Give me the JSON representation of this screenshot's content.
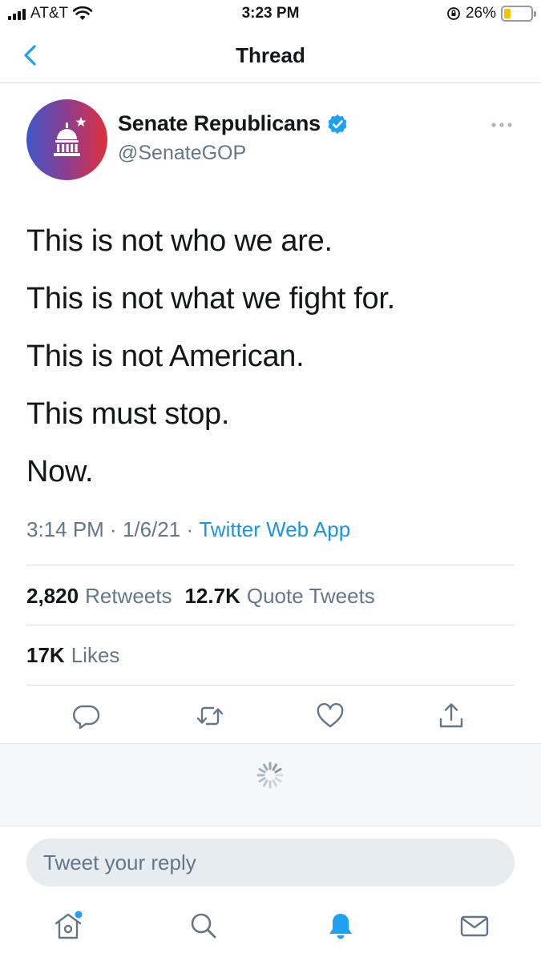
{
  "status_bar": {
    "carrier": "AT&T",
    "time": "3:23 PM",
    "battery_percent": "26%",
    "battery_level": 0.26
  },
  "nav": {
    "title": "Thread",
    "back_icon": "chevron-left-icon"
  },
  "tweet": {
    "author_name": "Senate Republicans",
    "author_handle": "@SenateGOP",
    "verified": true,
    "lines": [
      "This is not who we are.",
      "This is not what we fight for.",
      "This is not American.",
      "This must stop.",
      "Now."
    ],
    "time": "3:14 PM",
    "date": "1/6/21",
    "source": "Twitter Web App",
    "separator": " · ",
    "retweets_count": "2,820",
    "retweets_label": "Retweets",
    "quote_count": "12.7K",
    "quote_label": "Quote Tweets",
    "likes_count": "17K",
    "likes_label": "Likes"
  },
  "actions": [
    "reply-icon",
    "retweet-icon",
    "like-icon",
    "share-icon"
  ],
  "reply": {
    "placeholder": "Tweet your reply"
  },
  "tabbar": [
    "home-icon",
    "search-icon",
    "notifications-icon",
    "messages-icon"
  ],
  "colors": {
    "accent": "#1da1f2",
    "link": "#1b95e0",
    "secondary_text": "#657786",
    "divider": "#d8dde1"
  }
}
